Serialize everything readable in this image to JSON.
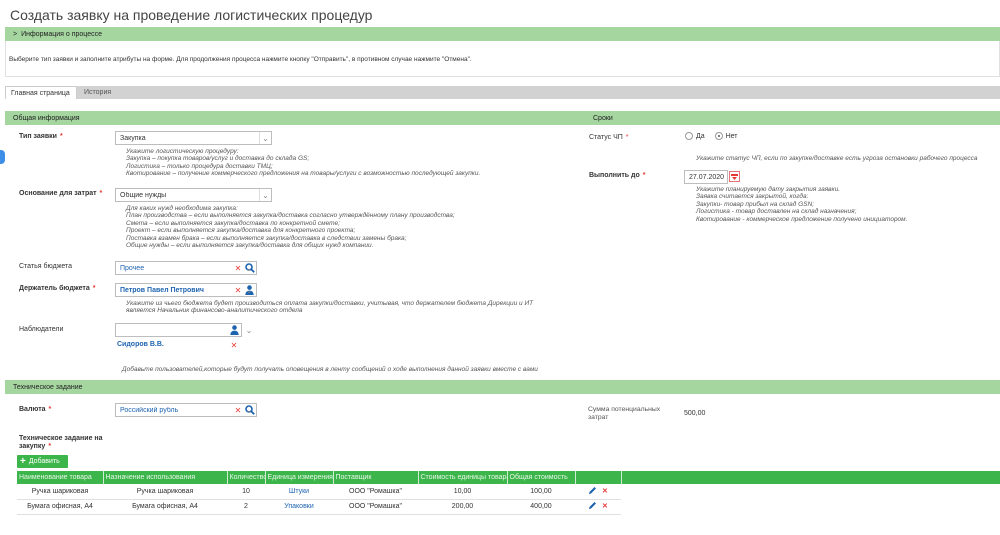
{
  "page": {
    "title": "Создать заявку на проведение логистических процедур"
  },
  "process_info": {
    "header": "Информация о процессе",
    "instruction": "Выберите тип заявки и заполните атрибуты на форме. Для продолжения процесса нажмите кнопку \"Отправить\", в противном случае нажмите \"Отмена\"."
  },
  "tabs": [
    {
      "label": "Главная страница"
    },
    {
      "label": "История"
    }
  ],
  "general": {
    "header": "Общая информация",
    "type_label": "Тип заявки",
    "type_value": "Закупка",
    "type_hint": [
      "Укажите логистическую процедуру:",
      "Закупка – покупка товаров/услуг и доставка до склада GS;",
      "Логистика – только процедура доставки ТМЦ;",
      "Квотирование – получение коммерческого предложения на товары/услуги с возможностью последующей закупки."
    ],
    "basis_label": "Основание для затрат",
    "basis_value": "Общие нужды",
    "basis_hint": [
      "Для каких нужд необходима закупка:",
      "План производства – если выполняется закупка/доставка согласно утверждённому плану производства;",
      "Смета – если выполняется закупка/доставка по конкретной смете;",
      "Проект – если выполняется закупка/доставка для конкретного проекта;",
      "Поставка взамен брака – если выполняется закупка/доставка в следствии замены брака;",
      "Общие нужды – если выполняется закупка/доставка для общих нужд компании."
    ],
    "budget_item_label": "Статья бюджета",
    "budget_item_value": "Прочее",
    "holder_label": "Держатель бюджета",
    "holder_value": "Петров Павел Петрович",
    "holder_hint": [
      "Укажите из чьего бюджета будет производиться оплата закупки/доставки, учитывая, что держателем бюджета Дирекции и ИТ",
      "является Начальник финансово-аналитического отдела"
    ],
    "observers_label": "Наблюдатели",
    "observer_name": "Сидоров В.В.",
    "observers_hint": "Добавьте пользователей,которые будут получать оповещения в ленту сообщений о ходе выполнения данной заявки вместе с вами"
  },
  "deadlines": {
    "header": "Сроки",
    "emergency_label": "Статус ЧП",
    "radio_yes": "Да",
    "radio_no": "Нет",
    "emergency_hint": "Укажите статус ЧП, если по закупке/доставке есть угроза остановки рабочего процесса",
    "due_label": "Выполнить до",
    "due_value": "27.07.2020",
    "due_hint": [
      "Укажите планируемую дату закрытия заявки.",
      "Заявка считается закрытой, когда:",
      "Закупки- товар прибыл на склад GSN;",
      "Логистика - товар доставлен на склад назначения;",
      "Квотирование - коммерческое предложение получено инициатором."
    ]
  },
  "tech": {
    "header": "Техническое задание",
    "currency_label": "Валюта",
    "currency_value": "Российский рубль",
    "sum_label": "Сумма потенциальных затрат",
    "sum_value": "500,00",
    "spec_label": "Техническое задание на закупку",
    "add_button": "Добавить",
    "columns": [
      "Наименование товара",
      "Назначение использования",
      "Количество",
      "Единица измерения",
      "Поставщик",
      "Стоимость единицы товара",
      "Общая стоимость"
    ],
    "rows": [
      [
        "Ручка шариковая",
        "Ручка шариковая",
        "10",
        "Штуки",
        "ООО \"Ромашка\"",
        "10,00",
        "100,00"
      ],
      [
        "Бумага офисная, А4",
        "Бумага офисная, А4",
        "2",
        "Упаковки",
        "ООО \"Ромашка\"",
        "200,00",
        "400,00"
      ]
    ]
  },
  "colors": {
    "green_bar": "#a5d6a0",
    "table_header": "#3cb54a",
    "link": "#1e63b0",
    "required": "#e53935"
  }
}
